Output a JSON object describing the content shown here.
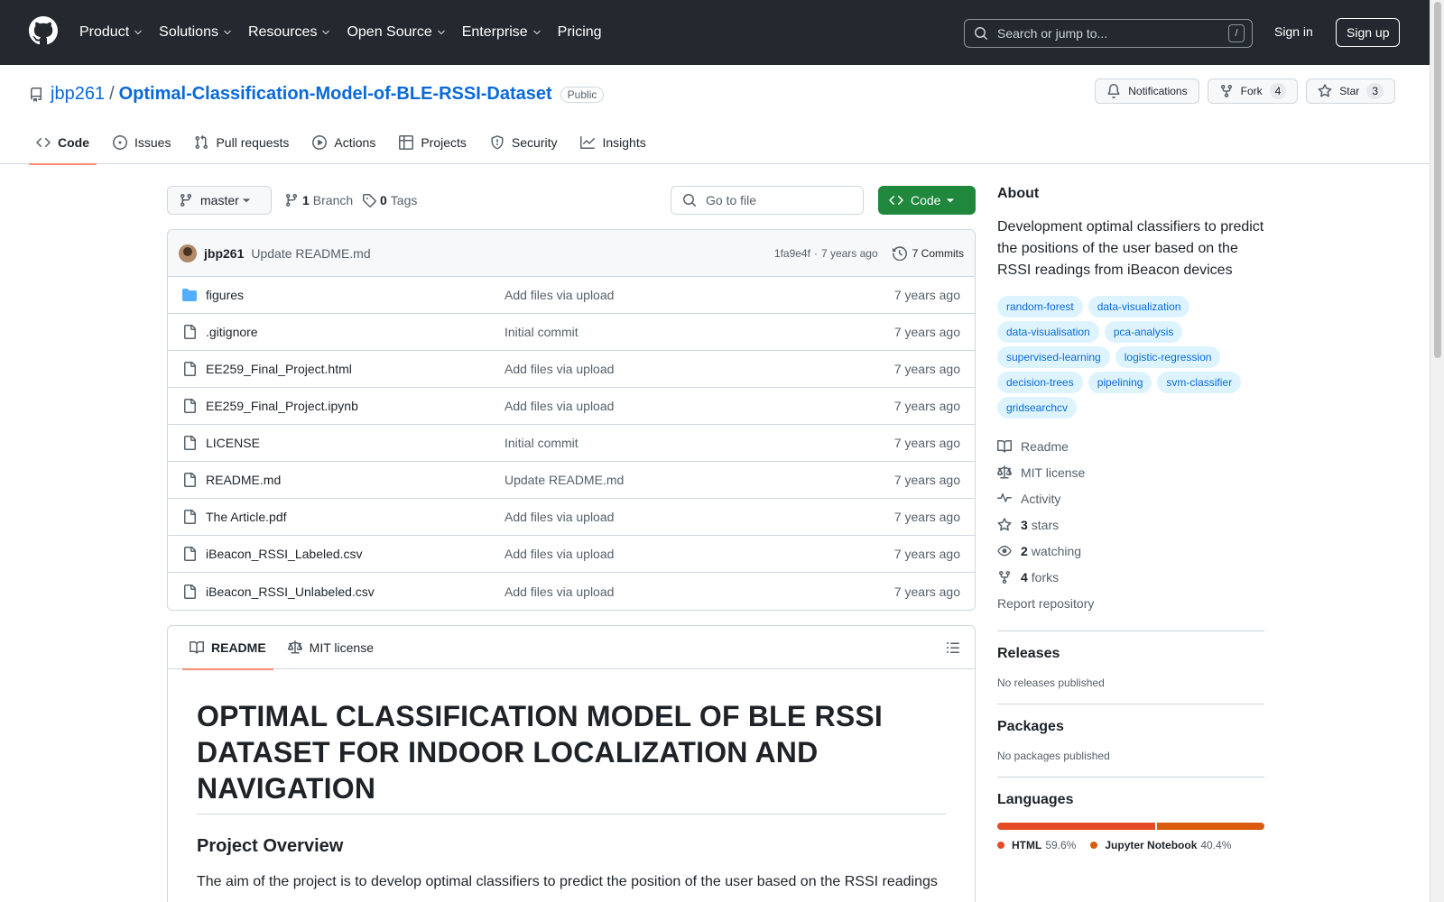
{
  "header": {
    "nav": [
      {
        "label": "Product",
        "dropdown": true
      },
      {
        "label": "Solutions",
        "dropdown": true
      },
      {
        "label": "Resources",
        "dropdown": true
      },
      {
        "label": "Open Source",
        "dropdown": true
      },
      {
        "label": "Enterprise",
        "dropdown": true
      },
      {
        "label": "Pricing",
        "dropdown": false
      }
    ],
    "search_placeholder": "Search or jump to...",
    "search_shortcut": "/",
    "sign_in": "Sign in",
    "sign_up": "Sign up"
  },
  "repo": {
    "owner": "jbp261",
    "separator": "/",
    "name": "Optimal-Classification-Model-of-BLE-RSSI-Dataset",
    "visibility": "Public",
    "notifications_label": "Notifications",
    "fork_label": "Fork",
    "fork_count": "4",
    "star_label": "Star",
    "star_count": "3"
  },
  "tabs": [
    "Code",
    "Issues",
    "Pull requests",
    "Actions",
    "Projects",
    "Security",
    "Insights"
  ],
  "toolbar": {
    "branch": "master",
    "branch_count": "1",
    "branch_label": "Branch",
    "tag_count": "0",
    "tag_label": "Tags",
    "goto_placeholder": "Go to file",
    "code_button": "Code"
  },
  "commit": {
    "author": "jbp261",
    "message": "Update README.md",
    "hash": "1fa9e4f",
    "dot": "·",
    "age": "7 years ago",
    "commits_label": "7 Commits"
  },
  "files": [
    {
      "name": "figures",
      "type": "folder",
      "message": "Add files via upload",
      "date": "7 years ago"
    },
    {
      "name": ".gitignore",
      "type": "file",
      "message": "Initial commit",
      "date": "7 years ago"
    },
    {
      "name": "EE259_Final_Project.html",
      "type": "file",
      "message": "Add files via upload",
      "date": "7 years ago"
    },
    {
      "name": "EE259_Final_Project.ipynb",
      "type": "file",
      "message": "Add files via upload",
      "date": "7 years ago"
    },
    {
      "name": "LICENSE",
      "type": "file",
      "message": "Initial commit",
      "date": "7 years ago"
    },
    {
      "name": "README.md",
      "type": "file",
      "message": "Update README.md",
      "date": "7 years ago"
    },
    {
      "name": "The Article.pdf",
      "type": "file",
      "message": "Add files via upload",
      "date": "7 years ago"
    },
    {
      "name": "iBeacon_RSSI_Labeled.csv",
      "type": "file",
      "message": "Add files via upload",
      "date": "7 years ago"
    },
    {
      "name": "iBeacon_RSSI_Unlabeled.csv",
      "type": "file",
      "message": "Add files via upload",
      "date": "7 years ago"
    }
  ],
  "readme": {
    "tab_readme": "README",
    "tab_license": "MIT license",
    "title": "OPTIMAL CLASSIFICATION MODEL OF BLE RSSI DATASET FOR INDOOR LOCALIZATION AND NAVIGATION",
    "section_title": "Project Overview",
    "paragraph": "The aim of the project is to develop optimal classifiers to predict the position of the user based on the RSSI readings"
  },
  "about": {
    "heading": "About",
    "description": "Development optimal classifiers to predict the positions of the user based on the RSSI readings from iBeacon devices",
    "topics": [
      "random-forest",
      "data-visualization",
      "data-visualisation",
      "pca-analysis",
      "supervised-learning",
      "logistic-regression",
      "decision-trees",
      "pipelining",
      "svm-classifier",
      "gridsearchcv"
    ],
    "links": {
      "readme": "Readme",
      "license": "MIT license",
      "activity": "Activity",
      "stars_count": "3",
      "stars_label": "stars",
      "watching_count": "2",
      "watching_label": "watching",
      "forks_count": "4",
      "forks_label": "forks",
      "report": "Report repository"
    }
  },
  "releases": {
    "heading": "Releases",
    "text": "No releases published"
  },
  "packages": {
    "heading": "Packages",
    "text": "No packages published"
  },
  "languages": {
    "heading": "Languages",
    "items": [
      {
        "name": "HTML",
        "percent": "59.6%",
        "value": 59.6,
        "color": "#e34c26"
      },
      {
        "name": "Jupyter Notebook",
        "percent": "40.4%",
        "value": 40.4,
        "color": "#DA5B0B"
      }
    ]
  }
}
